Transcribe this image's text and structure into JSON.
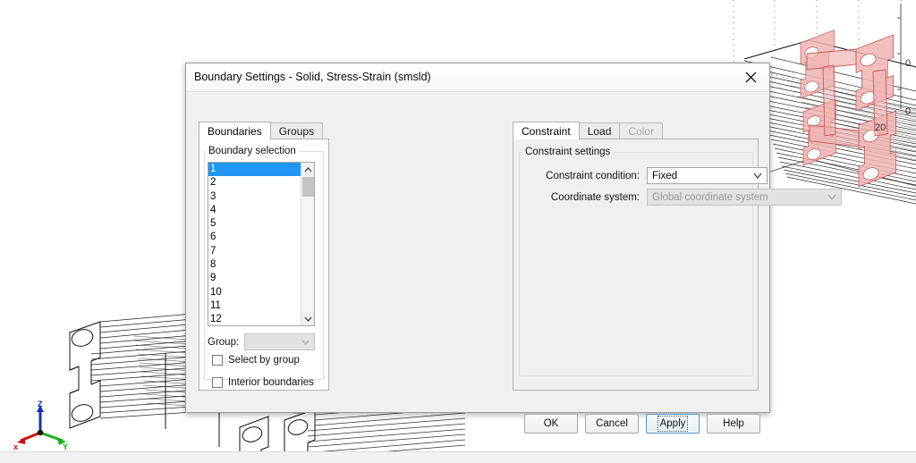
{
  "dialog": {
    "title": "Boundary Settings - Solid, Stress-Strain (smsld)",
    "close_icon": "close-icon"
  },
  "left_tabs": [
    {
      "label": "Boundaries",
      "state": "active"
    },
    {
      "label": "Groups",
      "state": "inactive"
    }
  ],
  "right_tabs": [
    {
      "label": "Constraint",
      "state": "active"
    },
    {
      "label": "Load",
      "state": "inactive"
    },
    {
      "label": "Color",
      "state": "disabled"
    }
  ],
  "boundary_selection": {
    "legend": "Boundary selection",
    "items": [
      "1",
      "2",
      "3",
      "4",
      "5",
      "6",
      "7",
      "8",
      "9",
      "10",
      "11",
      "12"
    ],
    "selected": "1",
    "group": {
      "label": "Group:",
      "value": "",
      "enabled": false
    },
    "checkboxes": [
      {
        "label": "Select by group",
        "checked": false
      },
      {
        "label": "Interior boundaries",
        "checked": false
      }
    ]
  },
  "constraint_settings": {
    "legend": "Constraint settings",
    "fields": [
      {
        "label": "Constraint condition:",
        "value": "Fixed",
        "enabled": true
      },
      {
        "label": "Coordinate system:",
        "value": "Global coordinate system",
        "enabled": false
      }
    ]
  },
  "buttons": [
    {
      "label": "OK",
      "default": false
    },
    {
      "label": "Cancel",
      "default": false
    },
    {
      "label": "Apply",
      "default": true
    },
    {
      "label": "Help",
      "default": false
    }
  ],
  "viewport": {
    "axis_triad": {
      "x": "x",
      "y": "Y",
      "z": "Z"
    },
    "axis_ticks": [
      "0",
      "0",
      "20"
    ],
    "selection_color": "#e8a0a0",
    "wireframe_color": "#1a1a1a"
  },
  "colors": {
    "accent": "#2196f3",
    "dialog_bg": "#f0f0f0",
    "selection_red": "#e8a0a0",
    "default_button_border": "#4a90c4"
  }
}
